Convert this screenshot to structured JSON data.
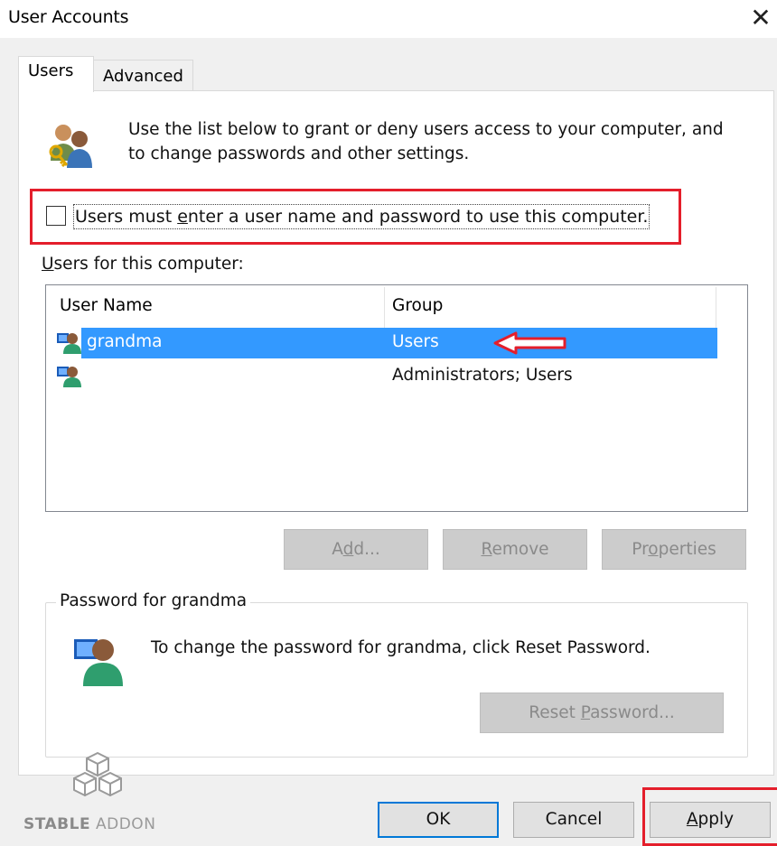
{
  "window": {
    "title": "User Accounts",
    "close_glyph": "✕"
  },
  "tabs": [
    {
      "label": "Users",
      "active": true
    },
    {
      "label": "Advanced",
      "active": false
    }
  ],
  "intro": {
    "icon": "users-keys-icon",
    "text": "Use the list below to grant or deny users access to your computer, and to change passwords and other settings."
  },
  "require_login": {
    "checked": false,
    "label_pre": "Users must ",
    "label_u": "e",
    "label_post": "nter a user name and password to use this computer."
  },
  "users_list": {
    "label_u": "U",
    "label_rest": "sers for this computer:",
    "columns": [
      "User Name",
      "Group"
    ],
    "rows": [
      {
        "name": "grandma",
        "group": "Users",
        "selected": true
      },
      {
        "name": "",
        "group": "Administrators; Users",
        "selected": false
      }
    ]
  },
  "list_buttons": {
    "add": {
      "pre": "A",
      "u": "d",
      "post": "d..."
    },
    "remove": {
      "pre": "",
      "u": "R",
      "post": "emove"
    },
    "properties": {
      "pre": "Pr",
      "u": "o",
      "post": "perties"
    }
  },
  "password_group": {
    "legend": "Password for grandma",
    "text": "To change the password for grandma, click Reset Password.",
    "reset_button": {
      "pre": "Reset ",
      "u": "P",
      "post": "assword..."
    }
  },
  "dialog_buttons": {
    "ok": "OK",
    "cancel": "Cancel",
    "apply_u": "A",
    "apply_rest": "pply"
  },
  "watermark": {
    "part1": "STABLE",
    "part2": " ADDON"
  },
  "colors": {
    "highlight": "#e41e2b",
    "selection": "#3399ff",
    "focus": "#0078d7"
  }
}
